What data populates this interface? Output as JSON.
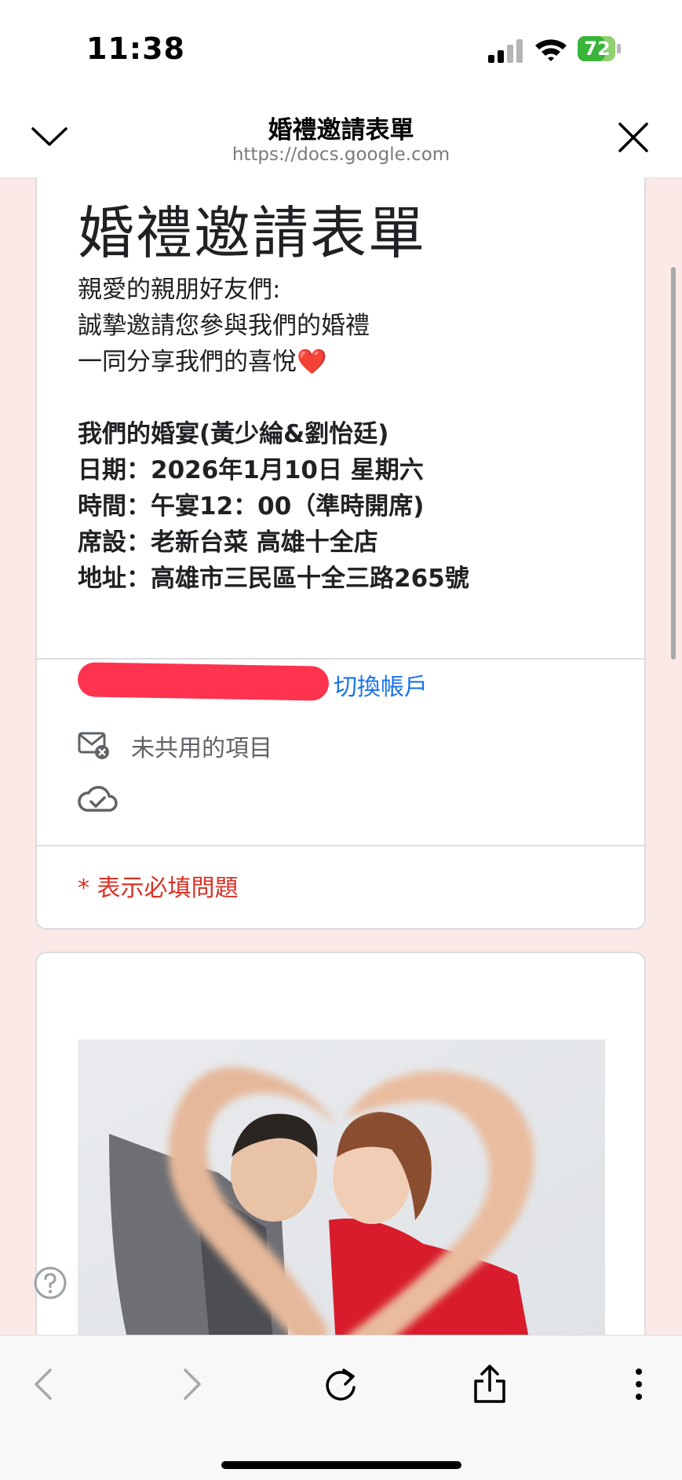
{
  "status_bar": {
    "time": "11:38",
    "battery": "72",
    "battery_level": 0.72,
    "charging": true
  },
  "browser_header": {
    "title": "婚禮邀請表單",
    "url": "https://docs.google.com"
  },
  "form": {
    "title": "婚禮邀請表單",
    "description": [
      "親愛的親朋好友們:",
      "誠摯邀請您參與我們的婚禮",
      "一同分享我們的喜悅"
    ],
    "heart": "❤️",
    "details": [
      "我們的婚宴(黃少綸&劉怡廷)",
      "日期：2026年1月10日  星期六",
      "時間：午宴12：00（準時開席)",
      "席設：老新台菜 高雄十全店",
      "地址：高雄市三民區十全三路265號"
    ],
    "switch_account": "切換帳戶",
    "not_shared": "未共用的項目",
    "required_note": "* 表示必填問題"
  },
  "icons": {
    "close": "chevron-down-icon",
    "dismiss": "close-icon",
    "mail_off": "mail-x-icon",
    "cloud": "cloud-check-icon",
    "help": "help-circle-icon",
    "back": "back-arrow-icon",
    "forward": "forward-arrow-icon",
    "reload": "reload-icon",
    "share": "share-icon",
    "more": "more-vertical-icon"
  },
  "colors": {
    "page_bg": "#fbe9e8",
    "link": "#1a73e8",
    "required": "#d93025",
    "redaction": "#fe334f"
  }
}
